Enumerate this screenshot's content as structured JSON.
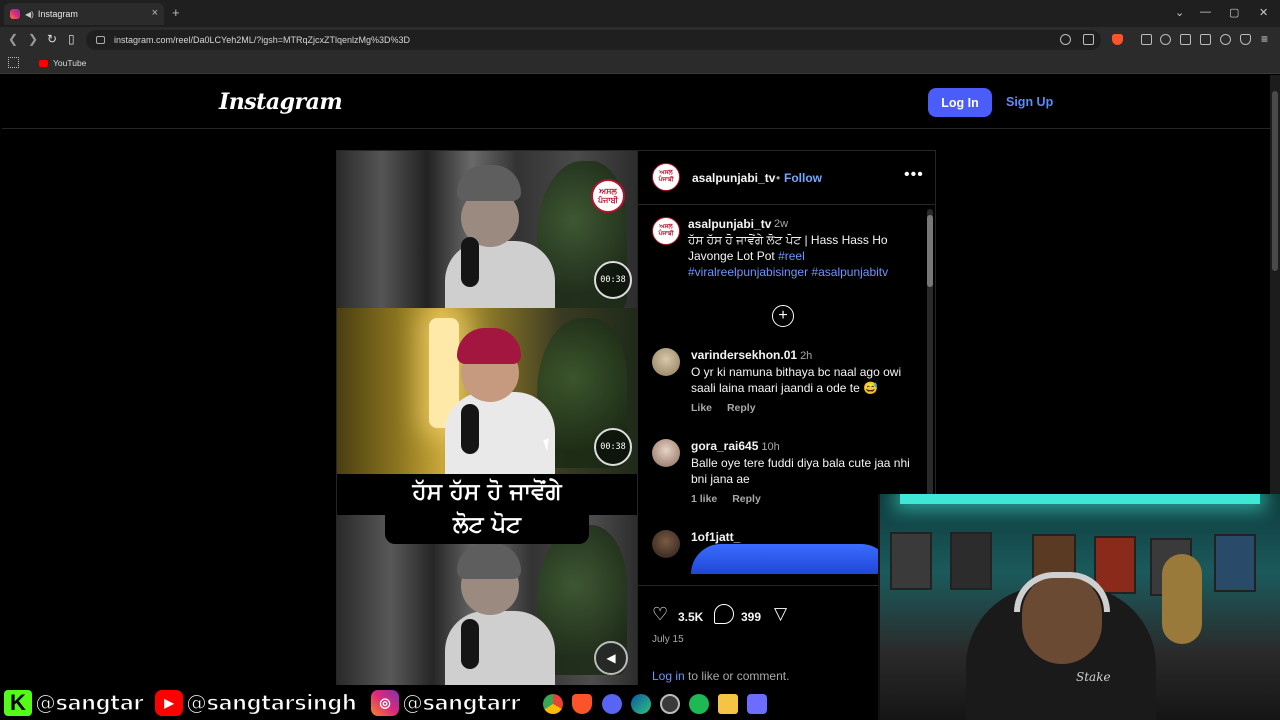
{
  "browser": {
    "tab_title": "Instagram",
    "url": "instagram.com/reel/Da0LCYeh2ML/?igsh=MTRqZjcxZTlqenlzMg%3D%3D",
    "bookmark_youtube": "YouTube",
    "tab_close": "×",
    "new_tab": "+"
  },
  "header": {
    "logo": "Instagram",
    "login_label": "Log In",
    "signup_label": "Sign Up"
  },
  "video": {
    "timer_1": "00:38",
    "timer_2": "00:38",
    "brand_badge": "ਅਸਲ ਪੰਜਾਬੀ",
    "caption_line1": "ਹੱਸ ਹੱਸ ਹੋ ਜਾਵੋਂਗੇ",
    "caption_line2": "ਲੋਟ ਪੋਟ"
  },
  "post": {
    "username": "asalpunjabi_tv",
    "dot": "•",
    "follow_label": "Follow",
    "more": "•••",
    "caption_user": "asalpunjabi_tv",
    "caption_time": "2w",
    "caption_text": "ਹੱਸ ਹੱਸ ਹੋ ਜਾਵੋਂਗੇ ਲੋਟ ਪੋਟ | Hass Hass Ho Javonge Lot Pot",
    "hashtag_1": "#reel",
    "hashtag_2": "#viralreelpunjabisinger",
    "hashtag_3": "#asalpunjabitv",
    "plus": "+"
  },
  "comments": [
    {
      "user": "varindersekhon.01",
      "time": "2h",
      "text": "O yr ki namuna bithaya bc naal ago owi saali laina maari jaandi a ode te 😅",
      "like": "Like",
      "reply": "Reply"
    },
    {
      "user": "gora_rai645",
      "time": "10h",
      "text": "Balle oye tere fuddi diya bala cute jaa nhi bni jana ae",
      "like": "1 like",
      "reply": "Reply"
    },
    {
      "user": "1of1jatt_"
    }
  ],
  "actions": {
    "likes": "3.5K",
    "comments": "399",
    "date": "July 15",
    "login_link": "Log in",
    "login_rest": " to like or comment."
  },
  "social": {
    "kick": "@sangtar",
    "youtube": "@sangtarsingh",
    "instagram": "@sangtarr",
    "kick_logo": "K",
    "youtube_logo": "▶",
    "instagram_logo": "◎"
  },
  "webcam": {
    "shirt_text": "Stake"
  },
  "colors": {
    "accent_blue": "#4a5df9",
    "link_blue": "#6c96ff",
    "brand_red": "#b3122c",
    "led_cyan": "#3fe8d6"
  }
}
